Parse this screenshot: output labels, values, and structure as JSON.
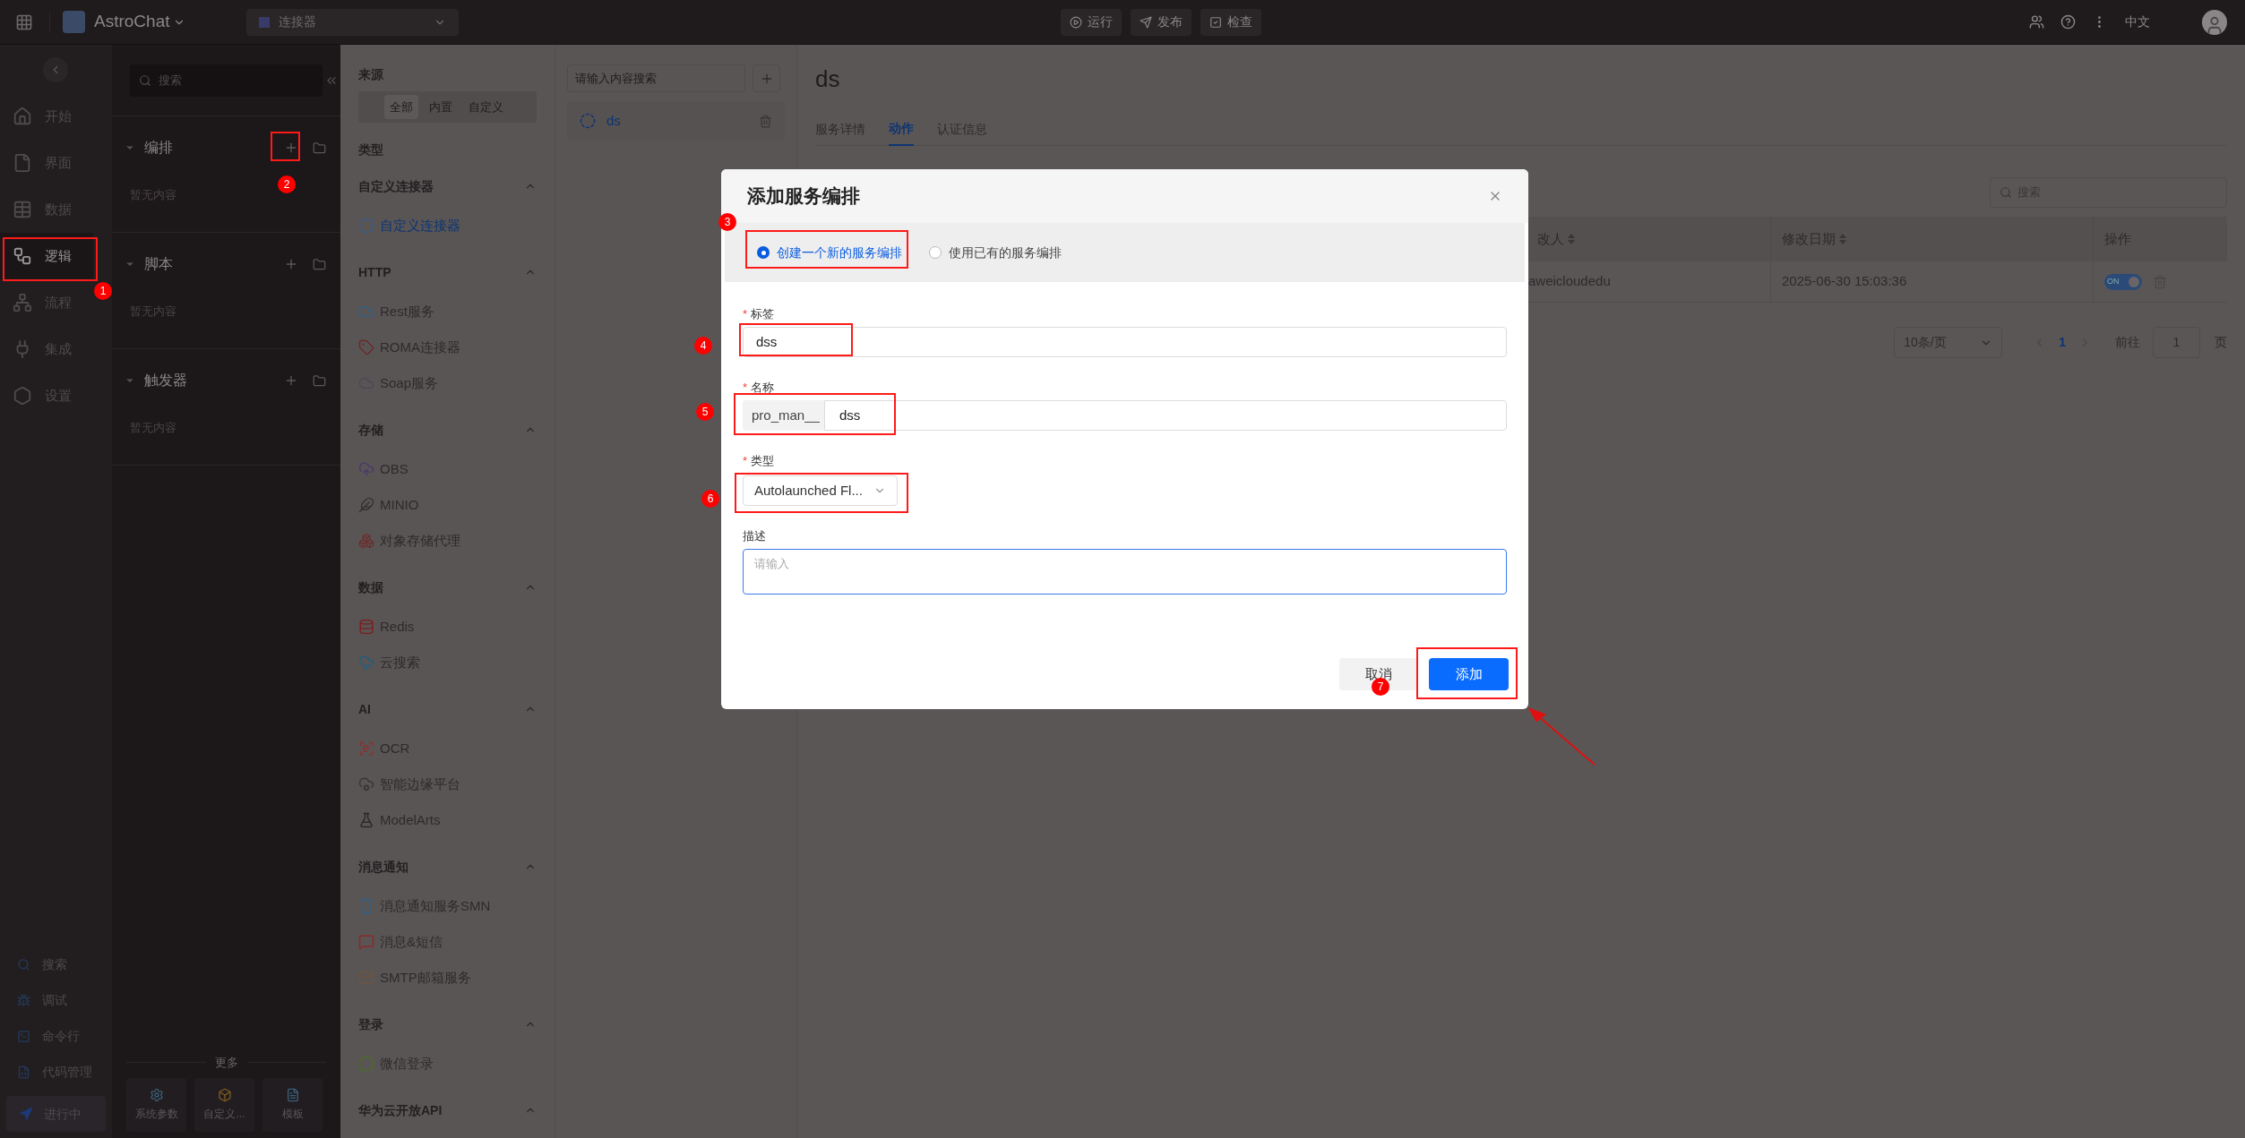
{
  "top_bar": {
    "app_name": "AstroChat",
    "selector": "连接器",
    "actions": [
      {
        "label": "运行"
      },
      {
        "label": "发布"
      },
      {
        "label": "检查"
      }
    ],
    "language": "中文"
  },
  "nav": {
    "items": [
      {
        "label": "开始",
        "selected": false
      },
      {
        "label": "界面",
        "selected": false
      },
      {
        "label": "数据",
        "selected": false
      },
      {
        "label": "逻辑",
        "selected": true
      },
      {
        "label": "流程",
        "selected": false
      },
      {
        "label": "集成",
        "selected": false
      },
      {
        "label": "设置",
        "selected": false
      }
    ],
    "bottom_items": [
      {
        "label": "搜索"
      },
      {
        "label": "调试"
      },
      {
        "label": "命令行"
      },
      {
        "label": "代码管理"
      }
    ],
    "status": "进行中"
  },
  "explorer": {
    "search_placeholder": "搜索",
    "sections": [
      {
        "title": "编排",
        "expanded": true,
        "empty_text": "暂无内容"
      },
      {
        "title": "脚本",
        "expanded": true,
        "empty_text": "暂无内容"
      },
      {
        "title": "触发器",
        "expanded": true,
        "empty_text": "暂无内容"
      }
    ],
    "more_label": "更多",
    "more_buttons": [
      {
        "label": "系统参数"
      },
      {
        "label": "自定义..."
      },
      {
        "label": "模板"
      }
    ]
  },
  "connectors": {
    "source_title": "来源",
    "source_tabs": [
      {
        "label": "全部",
        "selected": true
      },
      {
        "label": "内置",
        "selected": false
      },
      {
        "label": "自定义",
        "selected": false
      }
    ],
    "type_title": "类型",
    "groups": [
      {
        "title": "自定义连接器",
        "expanded": true,
        "items": [
          {
            "label": "自定义连接器",
            "selected": true
          }
        ]
      },
      {
        "title": "HTTP",
        "expanded": true,
        "items": [
          {
            "label": "Rest服务",
            "selected": false
          },
          {
            "label": "ROMA连接器",
            "selected": false
          },
          {
            "label": "Soap服务",
            "selected": false
          }
        ]
      },
      {
        "title": "存储",
        "expanded": true,
        "items": [
          {
            "label": "OBS",
            "selected": false
          },
          {
            "label": "MINIO",
            "selected": false
          },
          {
            "label": "对象存储代理",
            "selected": false
          }
        ]
      },
      {
        "title": "数据",
        "expanded": true,
        "items": [
          {
            "label": "Redis",
            "selected": false
          },
          {
            "label": "云搜索",
            "selected": false
          }
        ]
      },
      {
        "title": "AI",
        "expanded": true,
        "items": [
          {
            "label": "OCR",
            "selected": false
          },
          {
            "label": "智能边缘平台",
            "selected": false
          },
          {
            "label": "ModelArts",
            "selected": false
          }
        ]
      },
      {
        "title": "消息通知",
        "expanded": true,
        "items": [
          {
            "label": "消息通知服务SMN",
            "selected": false
          },
          {
            "label": "消息&短信",
            "selected": false
          },
          {
            "label": "SMTP邮箱服务",
            "selected": false
          }
        ]
      },
      {
        "title": "登录",
        "expanded": true,
        "items": [
          {
            "label": "微信登录",
            "selected": false
          }
        ]
      },
      {
        "title": "华为云开放API",
        "expanded": true
      }
    ]
  },
  "service_list": {
    "search_placeholder": "请输入内容搜索",
    "items": [
      {
        "label": "ds"
      }
    ]
  },
  "detail": {
    "title": "ds",
    "tabs": [
      {
        "label": "服务详情",
        "selected": false
      },
      {
        "label": "动作",
        "selected": true
      },
      {
        "label": "认证信息",
        "selected": false
      }
    ],
    "search_placeholder": "搜索",
    "table": {
      "columns": [
        {
          "label": "改人",
          "sortable": true
        },
        {
          "label": "修改日期",
          "sortable": true
        },
        {
          "label": "操作",
          "sortable": false
        }
      ],
      "rows": [
        {
          "modifier": "aweicloudedu",
          "modified": "2025-06-30 15:03:36",
          "toggle_label": "ON",
          "on": true
        }
      ]
    },
    "pagination": {
      "page_size": "10条/页",
      "current_page": "1",
      "goto_label": "前往",
      "goto_value": "1",
      "page_suffix": "页"
    }
  },
  "dialog": {
    "title": "添加服务编排",
    "options": [
      {
        "label": "创建一个新的服务编排",
        "selected": true
      },
      {
        "label": "使用已有的服务编排",
        "selected": false
      }
    ],
    "fields": [
      {
        "kind": "text",
        "required_mark": "*",
        "label": "标签",
        "value": "dss"
      },
      {
        "kind": "prefixed",
        "required_mark": "*",
        "label": "名称",
        "prefix": "pro_man__",
        "value": "dss"
      },
      {
        "kind": "select",
        "required_mark": "*",
        "label": "类型",
        "value": "Autolaunched Fl..."
      },
      {
        "kind": "textarea",
        "label": "描述",
        "placeholder": "请输入"
      }
    ],
    "cancel": "取消",
    "confirm": "添加"
  },
  "annotations": [
    {
      "number": "1"
    },
    {
      "number": "2"
    },
    {
      "number": "3"
    },
    {
      "number": "4"
    },
    {
      "number": "5"
    },
    {
      "number": "6"
    },
    {
      "number": "7"
    }
  ]
}
